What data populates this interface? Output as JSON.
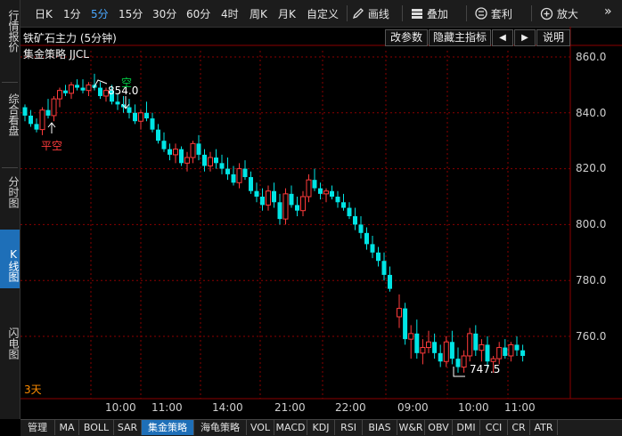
{
  "sidebar": {
    "tabs": [
      {
        "label": "行情报价",
        "active": false
      },
      {
        "label": "综合看盘",
        "active": false
      },
      {
        "label": "分时图",
        "active": false
      },
      {
        "label": "K线图",
        "active": true
      },
      {
        "label": "闪电图",
        "active": false
      }
    ]
  },
  "toolbar": {
    "periods": [
      "日K",
      "1分",
      "5分",
      "15分",
      "30分",
      "60分",
      "4时",
      "周K",
      "月K",
      "自定义"
    ],
    "active_period": "5分",
    "draw_label": "画线",
    "overlay_label": "叠加",
    "arbitrage_label": "套利",
    "zoom_label": "放大"
  },
  "chart": {
    "title": "铁矿石主力 (5分钟)",
    "strategy_label": "集金策略 JJCL",
    "buttons": {
      "params": "改参数",
      "hide_indicator": "隐藏主指标",
      "prev": "◀",
      "next": "▶",
      "help": "说明"
    },
    "days_label": "3天",
    "annotations": {
      "open_high": "854.0",
      "open_high_signal": "空",
      "close_short": "平空",
      "low": "747.5"
    },
    "colors": {
      "up": "#ff3b3b",
      "down": "#00e5e5",
      "grid": "#8b0000",
      "buy": "#ff3b3b",
      "sell": "#00cc44"
    }
  },
  "chart_data": {
    "type": "candlestick",
    "title": "铁矿石主力 (5分钟)",
    "y_ticks": [
      "860.0",
      "840.0",
      "820.0",
      "800.0",
      "780.0",
      "760.0"
    ],
    "x_ticks": [
      "10:00",
      "11:00",
      "14:00",
      "21:00",
      "22:00",
      "09:00",
      "10:00",
      "11:00"
    ],
    "ylim": [
      741,
      863
    ],
    "candles": [
      [
        842,
        843,
        837,
        839
      ],
      [
        839,
        841,
        835,
        836
      ],
      [
        836,
        838,
        833,
        834
      ],
      [
        834,
        842,
        832,
        841
      ],
      [
        841,
        845,
        838,
        839
      ],
      [
        839,
        846,
        837,
        845
      ],
      [
        845,
        849,
        842,
        848
      ],
      [
        848,
        850,
        846,
        847
      ],
      [
        847,
        851,
        845,
        850
      ],
      [
        850,
        852,
        848,
        849
      ],
      [
        849,
        852,
        847,
        848
      ],
      [
        848,
        851,
        846,
        850
      ],
      [
        850,
        854,
        848,
        849
      ],
      [
        849,
        851,
        845,
        846
      ],
      [
        846,
        849,
        844,
        848
      ],
      [
        848,
        850,
        843,
        844
      ],
      [
        844,
        847,
        841,
        843
      ],
      [
        843,
        846,
        840,
        842
      ],
      [
        842,
        845,
        838,
        840
      ],
      [
        840,
        843,
        836,
        837
      ],
      [
        837,
        841,
        834,
        840
      ],
      [
        840,
        844,
        837,
        838
      ],
      [
        838,
        840,
        833,
        834
      ],
      [
        834,
        836,
        829,
        830
      ],
      [
        830,
        833,
        826,
        827
      ],
      [
        827,
        829,
        823,
        825
      ],
      [
        825,
        829,
        822,
        827
      ],
      [
        827,
        828,
        821,
        822
      ],
      [
        822,
        826,
        819,
        824
      ],
      [
        824,
        830,
        822,
        829
      ],
      [
        829,
        832,
        823,
        825
      ],
      [
        825,
        827,
        819,
        821
      ],
      [
        821,
        826,
        819,
        824
      ],
      [
        824,
        827,
        820,
        822
      ],
      [
        822,
        825,
        818,
        820
      ],
      [
        820,
        824,
        816,
        818
      ],
      [
        818,
        821,
        814,
        815
      ],
      [
        815,
        822,
        813,
        820
      ],
      [
        820,
        823,
        816,
        817
      ],
      [
        817,
        819,
        811,
        812
      ],
      [
        812,
        815,
        808,
        810
      ],
      [
        810,
        813,
        805,
        807
      ],
      [
        807,
        814,
        805,
        812
      ],
      [
        812,
        815,
        806,
        808
      ],
      [
        808,
        811,
        800,
        802
      ],
      [
        802,
        813,
        800,
        811
      ],
      [
        811,
        814,
        806,
        807
      ],
      [
        807,
        810,
        803,
        805
      ],
      [
        805,
        812,
        803,
        810
      ],
      [
        810,
        818,
        808,
        816
      ],
      [
        816,
        820,
        812,
        813
      ],
      [
        813,
        815,
        809,
        811
      ],
      [
        811,
        813,
        808,
        812
      ],
      [
        812,
        814,
        809,
        810
      ],
      [
        810,
        812,
        806,
        808
      ],
      [
        808,
        811,
        805,
        806
      ],
      [
        806,
        808,
        802,
        803
      ],
      [
        803,
        806,
        798,
        800
      ],
      [
        800,
        803,
        795,
        797
      ],
      [
        797,
        799,
        791,
        793
      ],
      [
        793,
        796,
        788,
        790
      ],
      [
        790,
        792,
        785,
        787
      ],
      [
        787,
        790,
        780,
        782
      ],
      [
        782,
        785,
        776,
        777
      ],
      [
        767,
        775,
        763,
        770
      ],
      [
        770,
        772,
        757,
        759
      ],
      [
        759,
        764,
        752,
        761
      ],
      [
        761,
        766,
        752,
        754
      ],
      [
        754,
        759,
        750,
        756
      ],
      [
        756,
        762,
        754,
        758
      ],
      [
        758,
        761,
        752,
        754
      ],
      [
        754,
        757,
        749,
        751
      ],
      [
        751,
        760,
        749,
        758
      ],
      [
        758,
        762,
        750,
        752
      ],
      [
        752,
        756,
        747,
        749
      ],
      [
        749,
        755,
        747,
        753
      ],
      [
        753,
        763,
        751,
        761
      ],
      [
        761,
        764,
        753,
        755
      ],
      [
        755,
        759,
        751,
        757
      ],
      [
        757,
        760,
        749,
        751
      ],
      [
        751,
        753,
        747,
        752
      ],
      [
        752,
        758,
        750,
        756
      ],
      [
        756,
        759,
        752,
        753
      ],
      [
        753,
        758,
        751,
        757
      ],
      [
        757,
        760,
        753,
        755
      ],
      [
        755,
        757,
        751,
        753
      ]
    ]
  },
  "bottom_tabs": {
    "items": [
      "管理",
      "MA",
      "BOLL",
      "SAR",
      "集金策略",
      "海龟策略",
      "VOL",
      "MACD",
      "KDJ",
      "RSI",
      "BIAS",
      "W&R",
      "OBV",
      "DMI",
      "CCI",
      "CR",
      "ATR"
    ],
    "active": "集金策略"
  }
}
